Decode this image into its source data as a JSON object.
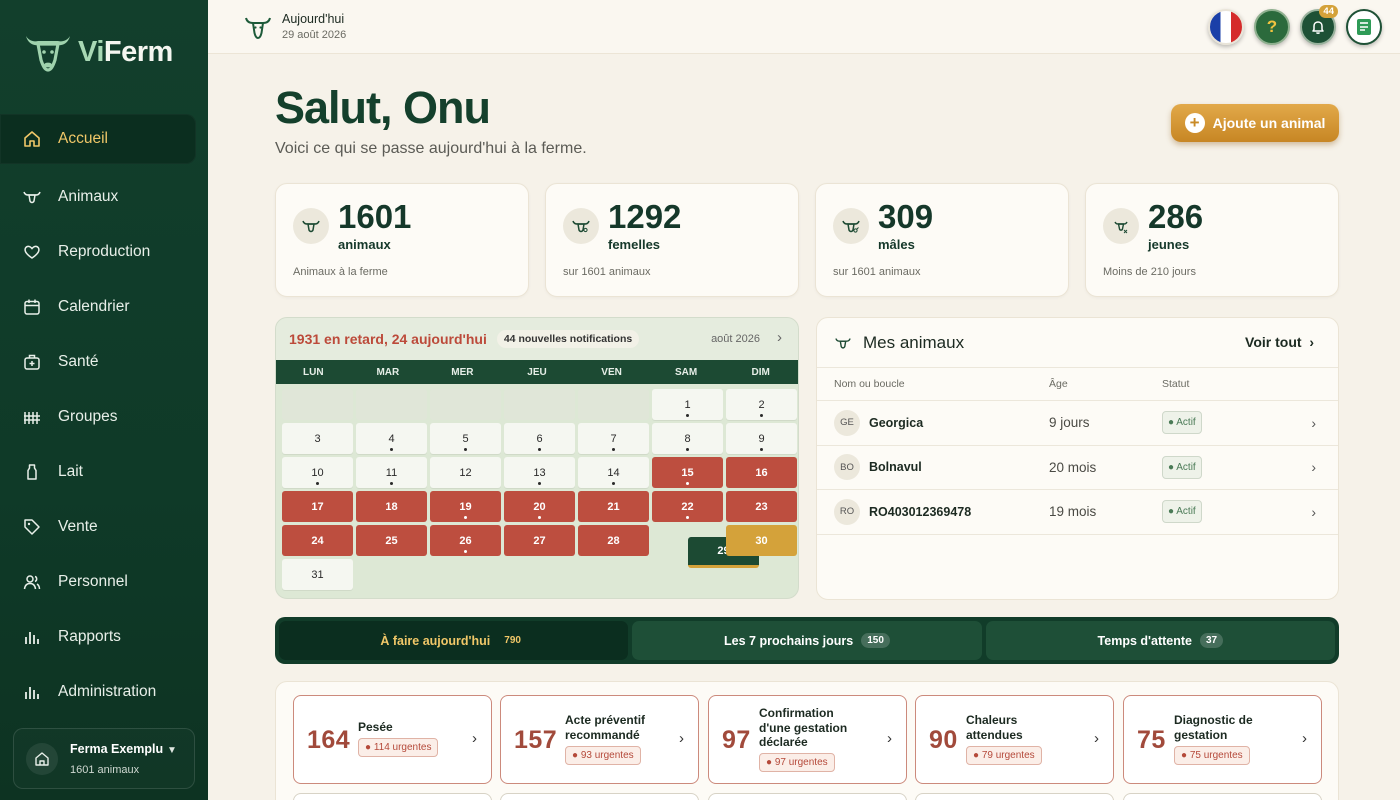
{
  "app": {
    "logo_prefix": "Vi",
    "logo_suffix": "Ferm"
  },
  "sidebar": {
    "items": [
      {
        "label": "Accueil",
        "icon": "home-icon",
        "active": true
      },
      {
        "label": "Animaux",
        "icon": "cow-icon"
      },
      {
        "label": "Reproduction",
        "icon": "heart-icon"
      },
      {
        "label": "Calendrier",
        "icon": "calendar-icon"
      },
      {
        "label": "Santé",
        "icon": "medical-kit-icon"
      },
      {
        "label": "Groupes",
        "icon": "fence-icon"
      },
      {
        "label": "Lait",
        "icon": "milk-bottle-icon"
      },
      {
        "label": "Vente",
        "icon": "tag-icon"
      },
      {
        "label": "Personnel",
        "icon": "users-icon"
      },
      {
        "label": "Rapports",
        "icon": "bar-chart-icon"
      },
      {
        "label": "Administration",
        "icon": "bar-chart-icon"
      }
    ],
    "farm": {
      "name": "Ferma Exemplu",
      "count": "1601 animaux"
    }
  },
  "topbar": {
    "title": "Aujourd'hui",
    "date": "29 août 2026",
    "notification_count": "44",
    "help_symbol": "?"
  },
  "main": {
    "greeting": "Salut, Onu",
    "subtitle": "Voici ce qui se passe aujourd'hui à la ferme.",
    "add_button": "Ajoute un animal"
  },
  "stats": [
    {
      "value": "1601",
      "unit": "animaux",
      "caption": "Animaux à la ferme"
    },
    {
      "value": "1292",
      "unit": "femelles",
      "caption": "sur 1601 animaux"
    },
    {
      "value": "309",
      "unit": "mâles",
      "caption": "sur 1601 animaux"
    },
    {
      "value": "286",
      "unit": "jeunes",
      "caption": "Moins de 210 jours"
    }
  ],
  "calendar": {
    "late_summary": "1931 en retard, 24 aujourd'hui",
    "notifications": "44 nouvelles notifications",
    "month": "août 2026",
    "weekdays": [
      "LUN",
      "MAR",
      "MER",
      "JEU",
      "VEN",
      "SAM",
      "DIM"
    ],
    "days": [
      {
        "d": "",
        "s": "empty"
      },
      {
        "d": "",
        "s": "empty"
      },
      {
        "d": "",
        "s": "empty"
      },
      {
        "d": "",
        "s": "empty"
      },
      {
        "d": "",
        "s": "empty"
      },
      {
        "d": "1",
        "s": "normal",
        "dot": true
      },
      {
        "d": "2",
        "s": "normal",
        "dot": true
      },
      {
        "d": "3",
        "s": "normal"
      },
      {
        "d": "4",
        "s": "normal",
        "dot": true
      },
      {
        "d": "5",
        "s": "normal",
        "dot": true
      },
      {
        "d": "6",
        "s": "normal",
        "dot": true
      },
      {
        "d": "7",
        "s": "normal",
        "dot": true
      },
      {
        "d": "8",
        "s": "normal",
        "dot": true
      },
      {
        "d": "9",
        "s": "normal",
        "dot": true
      },
      {
        "d": "10",
        "s": "normal",
        "dot": true
      },
      {
        "d": "11",
        "s": "normal",
        "dot": true
      },
      {
        "d": "12",
        "s": "normal"
      },
      {
        "d": "13",
        "s": "normal",
        "dot": true
      },
      {
        "d": "14",
        "s": "normal",
        "dot": true
      },
      {
        "d": "15",
        "s": "late",
        "dot": true
      },
      {
        "d": "16",
        "s": "late"
      },
      {
        "d": "17",
        "s": "late"
      },
      {
        "d": "18",
        "s": "late"
      },
      {
        "d": "19",
        "s": "late",
        "dot": true
      },
      {
        "d": "20",
        "s": "late",
        "dot": true
      },
      {
        "d": "21",
        "s": "late"
      },
      {
        "d": "22",
        "s": "late",
        "dot": true
      },
      {
        "d": "23",
        "s": "late"
      },
      {
        "d": "24",
        "s": "late"
      },
      {
        "d": "25",
        "s": "late"
      },
      {
        "d": "26",
        "s": "late",
        "dot": true
      },
      {
        "d": "27",
        "s": "late"
      },
      {
        "d": "28",
        "s": "late"
      },
      {
        "d": "29",
        "s": "today"
      },
      {
        "d": "30",
        "s": "future"
      },
      {
        "d": "31",
        "s": "normal"
      }
    ]
  },
  "animals": {
    "title": "Mes animaux",
    "see_all": "Voir tout",
    "columns": [
      "Nom ou boucle",
      "Âge",
      "Statut"
    ],
    "rows": [
      {
        "initials": "GE",
        "name": "Georgica",
        "age": "9 jours",
        "status": "● Actif"
      },
      {
        "initials": "BO",
        "name": "Bolnavul",
        "age": "20 mois",
        "status": "● Actif"
      },
      {
        "initials": "RO",
        "name": "RO403012369478",
        "age": "19 mois",
        "status": "● Actif"
      }
    ]
  },
  "tabs": [
    {
      "label": "À faire aujourd'hui",
      "count": "790",
      "active": true
    },
    {
      "label": "Les 7 prochains jours",
      "count": "150"
    },
    {
      "label": "Temps d'attente",
      "count": "37"
    }
  ],
  "tasks": [
    {
      "count": "164",
      "label": "Pesée",
      "urgent": "● 114 urgentes",
      "lines": 1
    },
    {
      "count": "157",
      "label": "Acte préventif recommandé",
      "urgent": "● 93 urgentes",
      "lines": 2
    },
    {
      "count": "97",
      "label": "Confirmation d'une gestation déclarée",
      "urgent": "● 97 urgentes",
      "lines": 3
    },
    {
      "count": "90",
      "label": "Chaleurs attendues",
      "urgent": "● 79 urgentes",
      "lines": 2
    },
    {
      "count": "75",
      "label": "Diagnostic de gestation",
      "urgent": "● 75 urgentes",
      "lines": 2
    }
  ],
  "colors": {
    "sidebar": "#123f2c",
    "accent_gold": "#d4a23a",
    "late_red": "#bd4e3f",
    "today_green": "#1c4a33"
  }
}
